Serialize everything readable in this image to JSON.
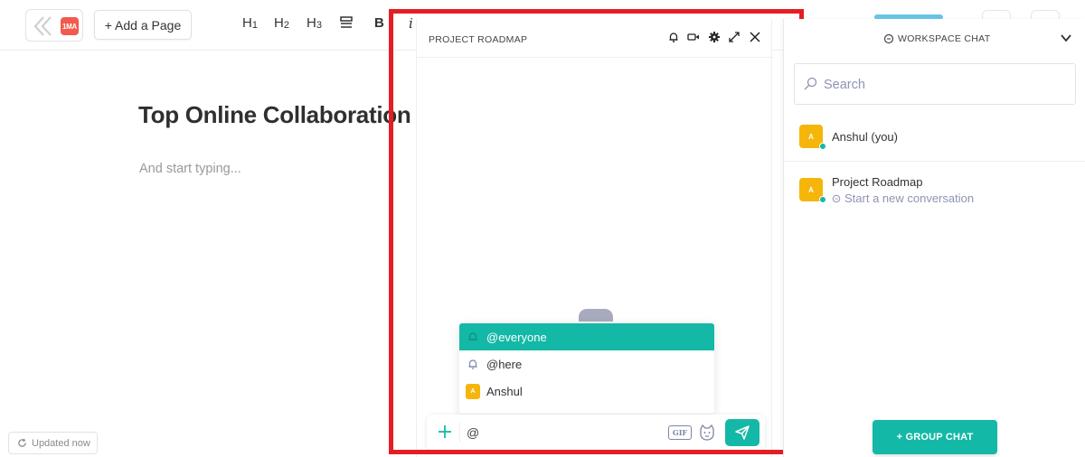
{
  "app": {
    "logo_text": "1MA",
    "add_page_label": "+ Add a Page"
  },
  "toolbar": {
    "h1": "H",
    "h1_sub": "1",
    "h2": "H",
    "h2_sub": "2",
    "h3": "H",
    "h3_sub": "3",
    "bold": "B",
    "italic": "i"
  },
  "document": {
    "title": "Top Online Collaboration",
    "placeholder": "And start typing...",
    "status": "Updated now"
  },
  "chat_window": {
    "title": "PROJECT ROADMAP",
    "mention_options": [
      {
        "label": "@everyone",
        "icon": "bell-icon",
        "active": true
      },
      {
        "label": "@here",
        "icon": "bell-icon",
        "active": false
      },
      {
        "label": "Anshul",
        "icon": "avatar",
        "avatar_letter": "A",
        "active": false
      }
    ],
    "composer_value": "@",
    "gif_label": "GIF"
  },
  "workspace_chat": {
    "title": "WORKSPACE CHAT",
    "search_placeholder": "Search",
    "conversations": [
      {
        "name": "Anshul (you)",
        "avatar_letter": "A",
        "online": true
      },
      {
        "name": "Project Roadmap",
        "avatar_letter": "A",
        "subtitle": "Start a new conversation",
        "online": true
      }
    ],
    "group_chat_label": "+ GROUP CHAT"
  },
  "colors": {
    "accent": "#14b8a6",
    "avatar": "#f5b50a",
    "highlight": "#e51e25",
    "logo": "#f25a4e"
  }
}
